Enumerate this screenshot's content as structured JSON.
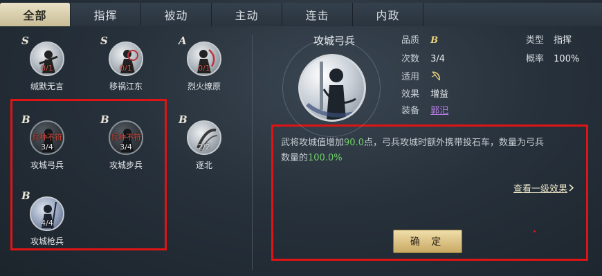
{
  "tabs": [
    "全部",
    "指挥",
    "被动",
    "主动",
    "连击",
    "内政"
  ],
  "skills": [
    {
      "grade": "S",
      "count": "0/1",
      "name": "缄默无言"
    },
    {
      "grade": "S",
      "count": "0/1",
      "name": "移祸江东"
    },
    {
      "grade": "A",
      "count": "0/1",
      "name": "烈火燎原"
    },
    {
      "grade": "B",
      "warning": "兵种不符",
      "count": "3/4",
      "name": "攻城弓兵"
    },
    {
      "grade": "B",
      "warning": "兵种不符",
      "count": "3/4",
      "name": "攻城步兵"
    },
    {
      "grade": "B",
      "count": "2/2",
      "name": "逐北"
    },
    {
      "grade": "B",
      "count": "4/4",
      "name": "攻城枪兵"
    }
  ],
  "detail": {
    "title": "攻城弓兵",
    "quality_label": "品质",
    "quality_value": "B",
    "times_label": "次数",
    "times_value": "3/4",
    "apply_label": "适用",
    "effect_label": "效果",
    "effect_value": "增益",
    "equip_label": "装备",
    "equip_value": "郭汜",
    "type_label": "类型",
    "type_value": "指挥",
    "rate_label": "概率",
    "rate_value": "100%",
    "desc_1": "武将攻城值增加",
    "desc_num1": "90.0",
    "desc_2": "点，弓兵攻城时额外携带投石车，数量为弓兵",
    "desc_3": "数量的",
    "desc_num2": "100.0%",
    "more": "查看一级效果",
    "confirm": "确 定"
  },
  "icons": {
    "apply_icon": "bow-icon",
    "more_icon": "chevron-right-icon"
  }
}
